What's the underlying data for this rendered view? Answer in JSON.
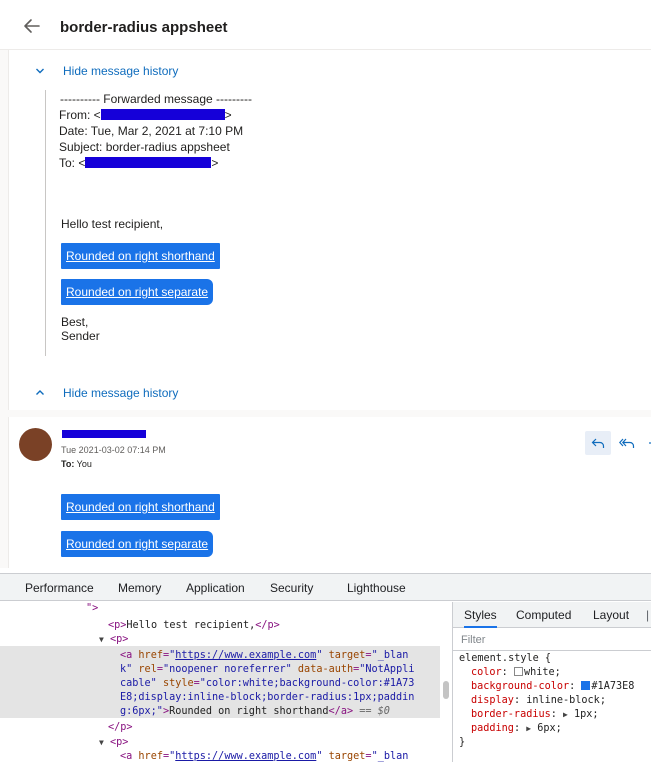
{
  "subject": "border-radius appsheet",
  "history": {
    "hide_label_top": "Hide message history",
    "hide_label_bottom": "Hide message history"
  },
  "forwarded": {
    "header": "---------- Forwarded message ---------",
    "from_prefix": "From: <",
    "from_suffix": ">",
    "date": "Date: Tue, Mar 2, 2021 at 7:10 PM",
    "subject": "Subject: border-radius appsheet",
    "to_prefix": "To: <",
    "to_suffix": ">"
  },
  "quoted_body": {
    "greeting": "Hello test recipient,",
    "button1": "Rounded on right shorthand",
    "button2": "Rounded on right separate",
    "closing": "Best,",
    "signature": "Sender"
  },
  "message": {
    "date": "Tue 2021-03-02 07:14 PM",
    "to_label": "To:",
    "to_value": "You",
    "button1": "Rounded on right shorthand",
    "button2": "Rounded on right separate",
    "avatar_color": "#7a4126"
  },
  "devtools": {
    "tabs": [
      "Performance",
      "Memory",
      "Application",
      "Security",
      "Lighthouse"
    ],
    "dom": {
      "l0": "\">",
      "p_open": "<p>",
      "p_text": "Hello test recipient,",
      "p_close": "</p>",
      "tri": "▼",
      "a_open": "<a",
      "href_attr": "href",
      "href_val": "https://www.example.com",
      "target_attr": "target",
      "target_val_1": "\"_blan",
      "target_val_2": "k\"",
      "rel_attr": "rel",
      "rel_val": "\"noopener noreferrer\"",
      "auth_attr": "data-auth",
      "auth_val_1": "\"NotAppli",
      "auth_val_2": "cable\"",
      "style_attr": "style",
      "style_val_1": "\"color:white;background-color:#1A73",
      "style_val_2": "E8;display:inline-block;border-radius:1px;paddin",
      "style_val_3": "g:6px;\"",
      "a_text": "Rounded on right shorthand",
      "a_close": "</a>",
      "eq": " == $0",
      "p_close_2": "</p>",
      "p_open_2": "<p>",
      "a_open_2": "<a",
      "href_val_2": "https://www.example.com",
      "target_val_3": "\"_blan"
    },
    "styles": {
      "tabs": [
        "Styles",
        "Computed",
        "Layout"
      ],
      "filter_placeholder": "Filter",
      "selector": "element.style {",
      "close_brace": "}",
      "props": [
        {
          "name": "color",
          "value": "white;"
        },
        {
          "name": "background-color",
          "value": "#1A73E8"
        },
        {
          "name": "display",
          "value": "inline-block;"
        },
        {
          "name": "border-radius",
          "value": "1px;"
        },
        {
          "name": "padding",
          "value": "6px;"
        }
      ],
      "swatch_white": "#ffffff",
      "swatch_blue": "#1a73e8"
    }
  },
  "colors": {
    "accent": "#0f6cbd",
    "button_bg": "#1a73e8",
    "redaction": "#1500d9"
  }
}
